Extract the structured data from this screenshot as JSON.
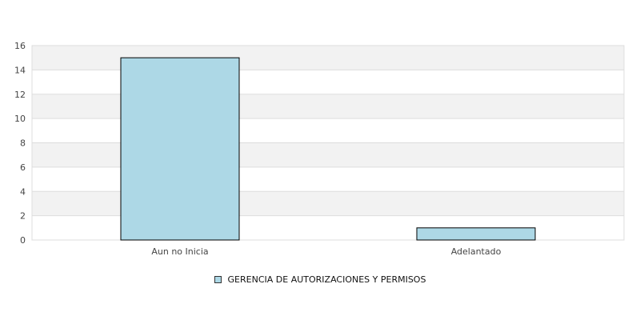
{
  "chart_data": {
    "type": "bar",
    "title": "",
    "xlabel": "",
    "ylabel": "",
    "categories": [
      "Aun no Inicia",
      "Adelantado"
    ],
    "series": [
      {
        "name": "GERENCIA DE AUTORIZACIONES Y PERMISOS",
        "values": [
          15,
          1
        ],
        "color": "#add8e6"
      }
    ],
    "ylim": [
      0,
      16
    ],
    "yticks": [
      0,
      2,
      4,
      6,
      8,
      10,
      12,
      14,
      16
    ],
    "grid": true,
    "legend_position": "bottom"
  },
  "colors": {
    "band_alt": "#f2f2f2",
    "band": "#ffffff",
    "grid": "#dddddd",
    "bar_stroke": "#000000"
  }
}
